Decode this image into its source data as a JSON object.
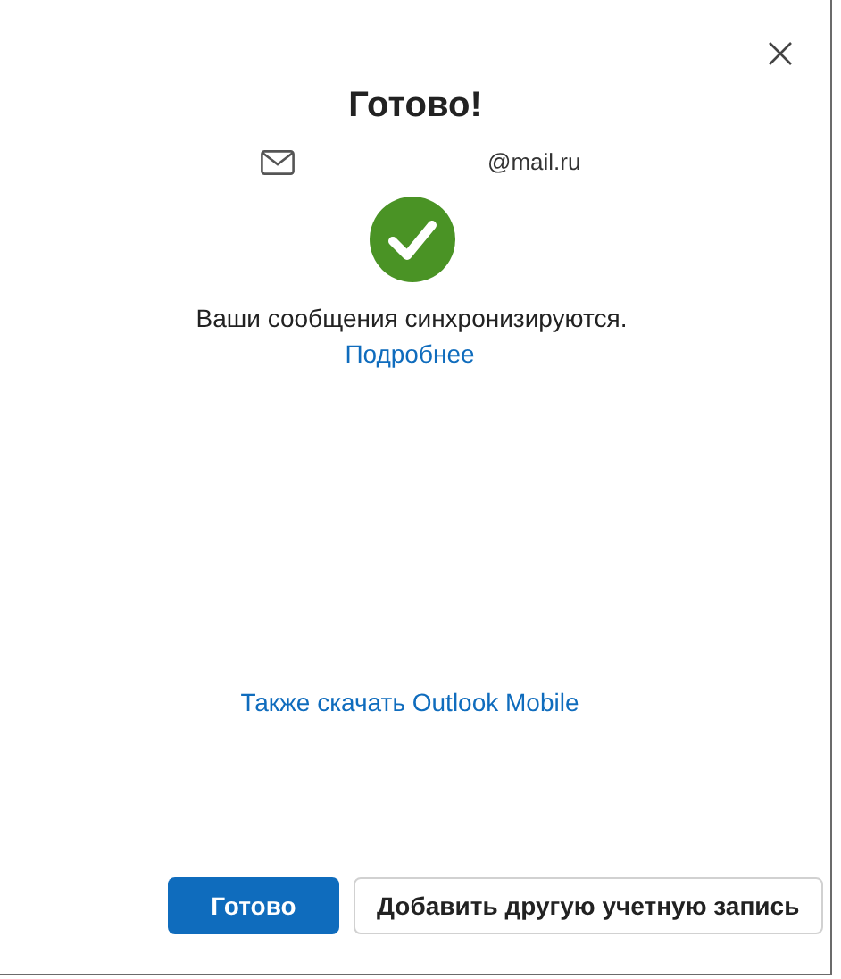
{
  "title": "Готово!",
  "account": {
    "email": "@mail.ru"
  },
  "message": "Ваши сообщения синхронизируются.",
  "details_link": "Подробнее",
  "mobile_link": "Также скачать Outlook Mobile",
  "buttons": [
    {
      "label": "Готово",
      "kind": "primary"
    },
    {
      "label": "Добавить другую учетную запись",
      "kind": "secondary"
    }
  ]
}
